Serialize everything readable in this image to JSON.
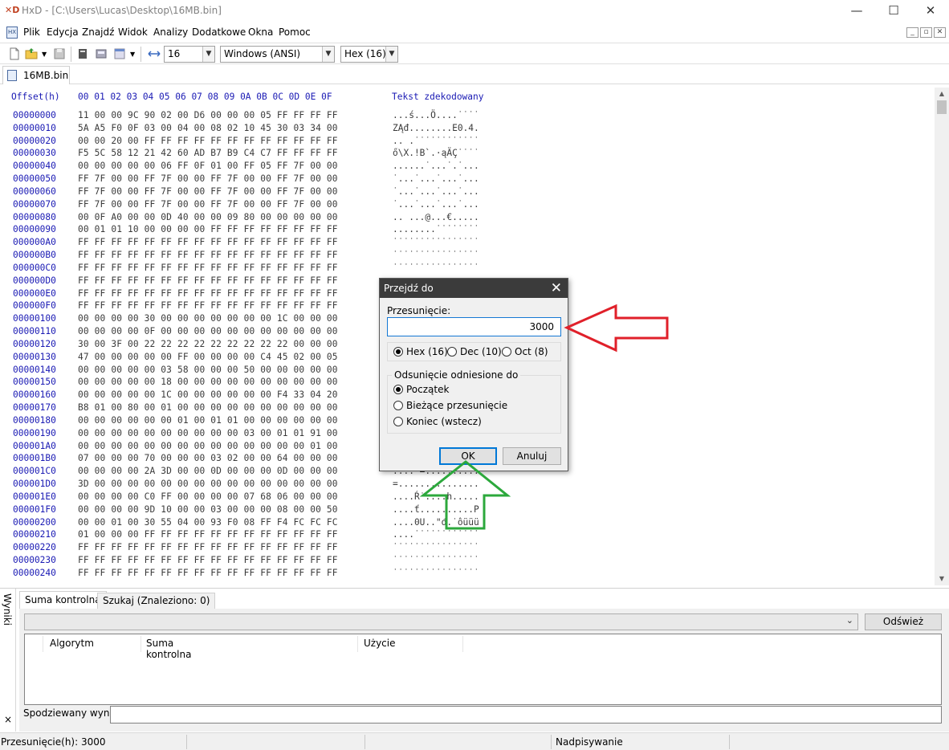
{
  "window": {
    "title": "HxD - [C:\\Users\\Lucas\\Desktop\\16MB.bin]"
  },
  "menu": [
    "Plik",
    "Edycja",
    "Znajdź",
    "Widok",
    "Analizy",
    "Dodatkowe",
    "Okna",
    "Pomoc"
  ],
  "toolbar": {
    "bytes_per_row": "16",
    "charset": "Windows (ANSI)",
    "offset_base": "Hex (16)"
  },
  "file_tab": "16MB.bin",
  "hex_view": {
    "offset_header": "Offset(h)",
    "column_header": "00 01 02 03 04 05 06 07 08 09 0A 0B 0C 0D 0E 0F",
    "text_header": "Tekst zdekodowany",
    "rows": [
      {
        "o": "00000000",
        "h": "11 00 00 9C 90 02 00 D6 00 00 00 05 FF FF FF FF",
        "t": "...ś...Ö....˙˙˙˙"
      },
      {
        "o": "00000010",
        "h": "5A A5 F0 0F 03 00 04 00 08 02 10 45 30 03 34 00",
        "t": "ZĄđ........E0.4."
      },
      {
        "o": "00000020",
        "h": "00 00 20 00 FF FF FF FF FF FF FF FF FF FF FF FF",
        "t": ".. .˙˙˙˙˙˙˙˙˙˙˙˙"
      },
      {
        "o": "00000030",
        "h": "F5 5C 58 12 21 42 60 AD B7 B9 C4 C7 FF FF FF FF",
        "t": "ő\\X.!B`.·ąÄÇ˙˙˙˙"
      },
      {
        "o": "00000040",
        "h": "00 00 00 00 00 06 FF 0F 01 00 FF 05 FF 7F 00 00",
        "t": "......˙...˙.˙..."
      },
      {
        "o": "00000050",
        "h": "FF 7F 00 00 FF 7F 00 00 FF 7F 00 00 FF 7F 00 00",
        "t": "˙...˙...˙...˙..."
      },
      {
        "o": "00000060",
        "h": "FF 7F 00 00 FF 7F 00 00 FF 7F 00 00 FF 7F 00 00",
        "t": "˙...˙...˙...˙..."
      },
      {
        "o": "00000070",
        "h": "FF 7F 00 00 FF 7F 00 00 FF 7F 00 00 FF 7F 00 00",
        "t": "˙...˙...˙...˙..."
      },
      {
        "o": "00000080",
        "h": "00 0F A0 00 00 0D 40 00 00 09 80 00 00 00 00 00",
        "t": ".. ...@...€....."
      },
      {
        "o": "00000090",
        "h": "00 01 01 10 00 00 00 00 FF FF FF FF FF FF FF FF",
        "t": "........˙˙˙˙˙˙˙˙"
      },
      {
        "o": "000000A0",
        "h": "FF FF FF FF FF FF FF FF FF FF FF FF FF FF FF FF",
        "t": "˙˙˙˙˙˙˙˙˙˙˙˙˙˙˙˙"
      },
      {
        "o": "000000B0",
        "h": "FF FF FF FF FF FF FF FF FF FF FF FF FF FF FF FF",
        "t": "˙˙˙˙˙˙˙˙˙˙˙˙˙˙˙˙"
      },
      {
        "o": "000000C0",
        "h": "FF FF FF FF FF FF FF FF FF FF FF FF FF FF FF FF",
        "t": "˙˙˙˙˙˙˙˙˙˙˙˙˙˙˙˙"
      },
      {
        "o": "000000D0",
        "h": "FF FF FF FF FF FF FF FF FF FF FF FF FF FF FF FF",
        "t": ""
      },
      {
        "o": "000000E0",
        "h": "FF FF FF FF FF FF FF FF FF FF FF FF FF FF FF FF",
        "t": ""
      },
      {
        "o": "000000F0",
        "h": "FF FF FF FF FF FF FF FF FF FF FF FF FF FF FF FF",
        "t": ""
      },
      {
        "o": "00000100",
        "h": "00 00 00 00 30 00 00 00 00 00 00 00 1C 00 00 00",
        "t": ""
      },
      {
        "o": "00000110",
        "h": "00 00 00 00 0F 00 00 00 00 00 00 00 00 00 00 00",
        "t": ""
      },
      {
        "o": "00000120",
        "h": "30 00 3F 00 22 22 22 22 22 22 22 22 22 00 00 00",
        "t": ""
      },
      {
        "o": "00000130",
        "h": "47 00 00 00 00 00 FF 00 00 00 00 C4 45 02 00 05",
        "t": ""
      },
      {
        "o": "00000140",
        "h": "00 00 00 00 00 03 58 00 00 00 50 00 00 00 00 00",
        "t": ""
      },
      {
        "o": "00000150",
        "h": "00 00 00 00 00 18 00 00 00 00 00 00 00 00 00 00",
        "t": ""
      },
      {
        "o": "00000160",
        "h": "00 00 00 00 00 1C 00 00 00 00 00 00 F4 33 04 20",
        "t": ""
      },
      {
        "o": "00000170",
        "h": "B8 01 00 80 00 01 00 00 00 00 00 00 00 00 00 00",
        "t": ""
      },
      {
        "o": "00000180",
        "h": "00 00 00 00 00 00 01 00 01 01 00 00 00 00 00 00",
        "t": ""
      },
      {
        "o": "00000190",
        "h": "00 00 00 00 00 00 00 00 00 00 03 00 01 01 91 00",
        "t": ""
      },
      {
        "o": "000001A0",
        "h": "00 00 00 00 00 00 00 00 00 00 00 00 00 00 01 00",
        "t": ""
      },
      {
        "o": "000001B0",
        "h": "07 00 00 00 70 00 00 00 03 02 00 00 64 00 00 00",
        "t": ""
      },
      {
        "o": "000001C0",
        "h": "00 00 00 00 2A 3D 00 00 0D 00 00 00 0D 00 00 00",
        "t": "....*=.........."
      },
      {
        "o": "000001D0",
        "h": "3D 00 00 00 00 00 00 00 00 00 00 00 00 00 00 00",
        "t": "=..............."
      },
      {
        "o": "000001E0",
        "h": "00 00 00 00 C0 FF 00 00 00 00 07 68 06 00 00 00",
        "t": "....Ŕ˙....h....."
      },
      {
        "o": "000001F0",
        "h": "00 00 00 00 9D 10 00 00 03 00 00 00 08 00 00 50",
        "t": "....ť..........P"
      },
      {
        "o": "00000200",
        "h": "00 00 01 00 30 55 04 00 93 F0 08 FF F4 FC FC FC",
        "t": "....0U..\"đ.˙ôüüü"
      },
      {
        "o": "00000210",
        "h": "01 00 00 00 FF FF FF FF FF FF FF FF FF FF FF FF",
        "t": "....˙˙˙˙˙˙˙˙˙˙˙˙"
      },
      {
        "o": "00000220",
        "h": "FF FF FF FF FF FF FF FF FF FF FF FF FF FF FF FF",
        "t": "˙˙˙˙˙˙˙˙˙˙˙˙˙˙˙˙"
      },
      {
        "o": "00000230",
        "h": "FF FF FF FF FF FF FF FF FF FF FF FF FF FF FF FF",
        "t": "˙˙˙˙˙˙˙˙˙˙˙˙˙˙˙˙"
      },
      {
        "o": "00000240",
        "h": "FF FF FF FF FF FF FF FF FF FF FF FF FF FF FF FF",
        "t": "˙˙˙˙˙˙˙˙˙˙˙˙˙˙˙˙"
      }
    ]
  },
  "dialog": {
    "title": "Przejdź do",
    "offset_label": "Przesunięcie:",
    "offset_value": "3000",
    "radix": {
      "hex": "Hex (16)",
      "dec": "Dec (10)",
      "oct": "Oct (8)",
      "selected": "hex"
    },
    "group_title": "Odsunięcie odniesione do",
    "relative": {
      "begin": "Początek",
      "current": "Bieżące przesunięcie",
      "end": "Koniec (wstecz)",
      "selected": "begin"
    },
    "ok": "OK",
    "cancel": "Anuluj"
  },
  "bottom_panel": {
    "side_title": "Wyniki",
    "close": "×",
    "tabs": [
      "Suma kontrolna",
      "Szukaj (Znaleziono: 0)"
    ],
    "refresh": "Odśwież",
    "columns": [
      "Algorytm",
      "Suma kontrolna",
      "Użycie"
    ],
    "expected_label": "Spodziewany wynik"
  },
  "status": {
    "offset": "Przesunięcie(h): 3000",
    "mode": "Nadpisywanie"
  },
  "colors": {
    "offset_blue": "#1a1ab4",
    "arrow_red": "#e0202a",
    "arrow_green": "#2ca83c",
    "dialog_title": "#3b3b3b",
    "focus_blue": "#1478d4"
  }
}
